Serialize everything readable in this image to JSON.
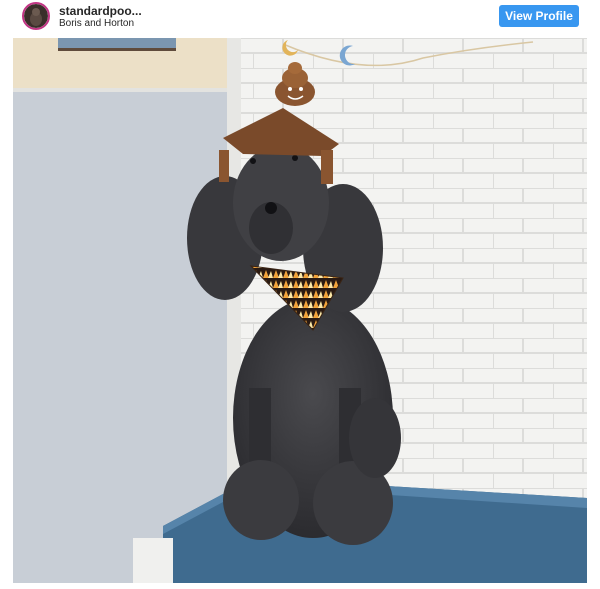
{
  "post": {
    "username": "standardpoo...",
    "subtitle": "Boris and Horton",
    "view_profile_label": "View Profile"
  },
  "image": {
    "content": "poodle-on-bench-photo"
  },
  "colors": {
    "button": "#3897f0",
    "text": "#262626",
    "avatar_ring": "#c13584"
  }
}
